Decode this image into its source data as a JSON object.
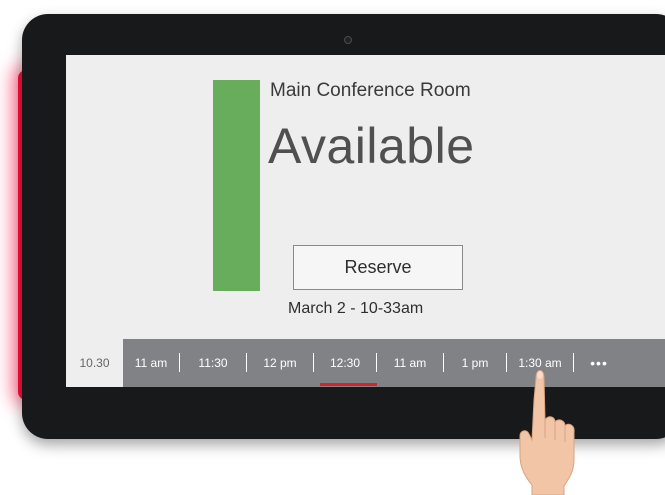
{
  "room": {
    "name": "Main Conference Room",
    "status": "Available",
    "status_color": "#67ad5b",
    "reserve_label": "Reserve",
    "datetime": "March 2 - 10-33am"
  },
  "timeline": {
    "current": "10.30",
    "slots": [
      "11 am",
      "11:30",
      "12 pm",
      "12:30",
      "11 am",
      "1 pm",
      "1:30 am"
    ],
    "active_slot": "12:30",
    "more_label": "•••",
    "accent_color": "#d8222b",
    "bar_color": "#808285"
  },
  "device": {
    "led_color": "#ff0a3c"
  }
}
